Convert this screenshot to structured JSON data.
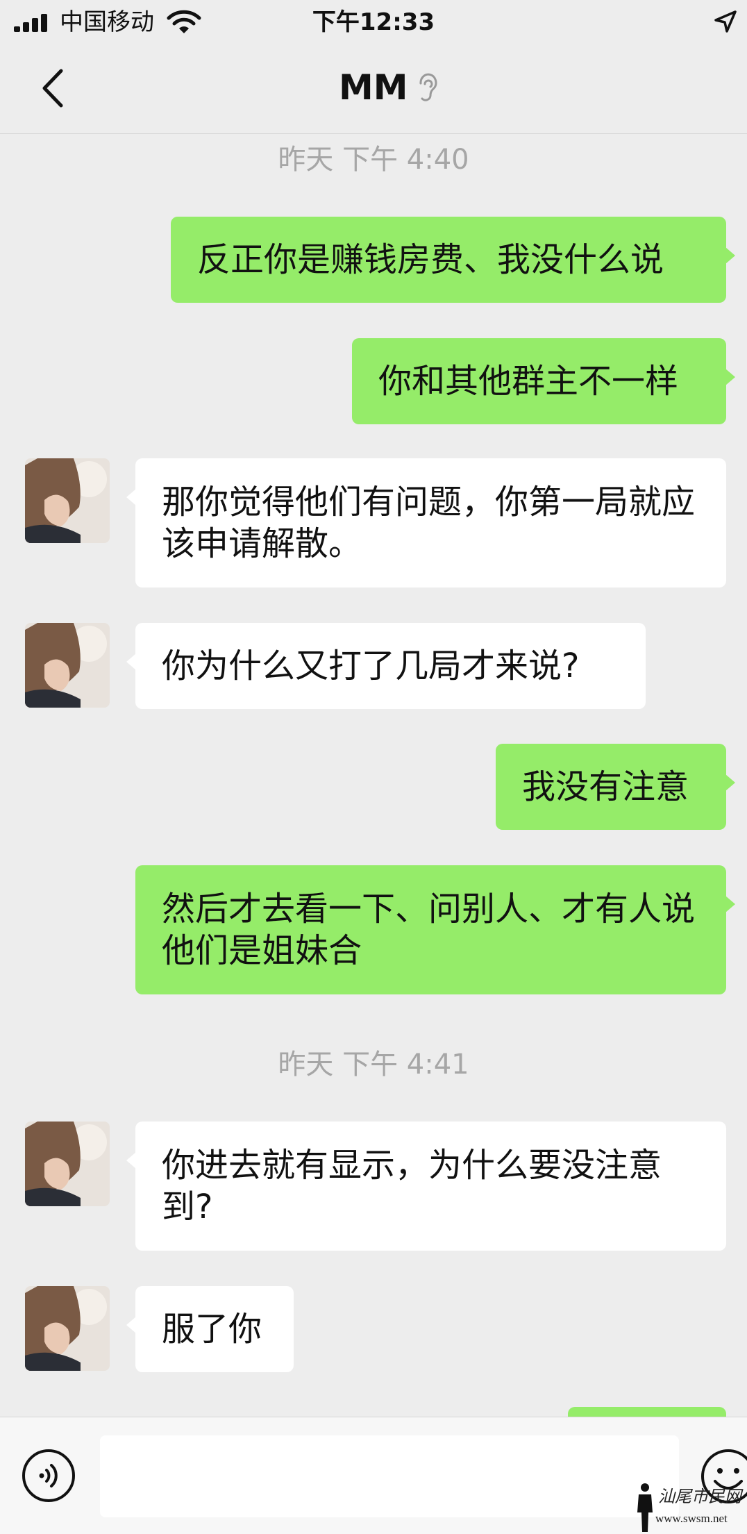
{
  "status_bar": {
    "carrier": "中国移动",
    "time": "下午12:33"
  },
  "nav": {
    "title": "MM",
    "back_icon": "chevron-left-icon",
    "title_icon": "ear-icon"
  },
  "messages": [
    {
      "kind": "time",
      "text": "昨天 下午 4:40"
    },
    {
      "kind": "out",
      "text": "反正你是赚钱房费、我没什么说"
    },
    {
      "kind": "out",
      "text": "你和其他群主不一样"
    },
    {
      "kind": "in",
      "text": "那你觉得他们有问题，你第一局就应该申请解散。"
    },
    {
      "kind": "in",
      "text": "你为什么又打了几局才来说?"
    },
    {
      "kind": "out",
      "text": "我没有注意"
    },
    {
      "kind": "out",
      "text": "然后才去看一下、问别人、才有人说他们是姐妹合"
    },
    {
      "kind": "time",
      "text": "昨天 下午 4:41"
    },
    {
      "kind": "in",
      "text": "你进去就有显示，为什么要没注意到?"
    },
    {
      "kind": "in",
      "text": "服了你"
    }
  ],
  "input_bar": {
    "voice_icon": "voice-icon",
    "emoji_icon": "emoji-icon",
    "value": ""
  },
  "watermark": {
    "text": "汕尾市民网",
    "url": "www.swsm.net"
  },
  "colors": {
    "background": "#ededed",
    "outgoing_bubble": "#95ec69",
    "incoming_bubble": "#ffffff",
    "time_label": "#a6a6a6"
  }
}
